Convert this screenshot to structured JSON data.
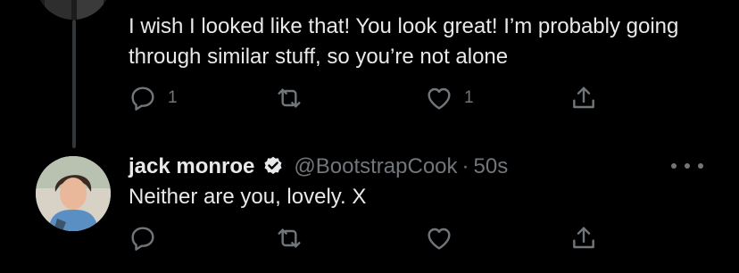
{
  "previous_tweet": {
    "text": "I wish I looked like that! You look great! I’m probably going through similar stuff, so you’re not alone",
    "reply_count": "1",
    "like_count": "1"
  },
  "reply_tweet": {
    "display_name": "jack monroe",
    "handle": "@BootstrapCook",
    "separator": "·",
    "time": "50s",
    "text": "Neither are you, lovely. X"
  },
  "icons": {
    "reply": "reply-icon",
    "retweet": "retweet-icon",
    "like": "like-icon",
    "share": "share-icon",
    "verified": "verified-badge-icon",
    "more": "more-options-icon"
  },
  "colors": {
    "background": "#000000",
    "text": "#e7e9ea",
    "muted": "#71767b",
    "thread_line": "#333639"
  }
}
